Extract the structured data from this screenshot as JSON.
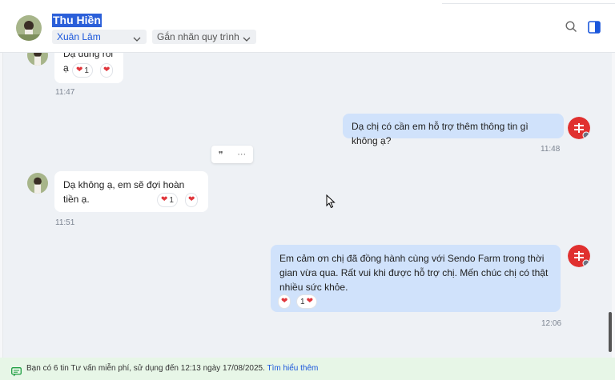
{
  "header": {
    "contact_name": "Thu Hiền",
    "assignee": "Xuân Lâm",
    "label_placeholder": "Gắn nhãn quy trình",
    "icons": [
      "search-icon",
      "sidebar-toggle-icon"
    ]
  },
  "messages": [
    {
      "text": "Dạ đúng rồi ạ",
      "time": "11:47",
      "reaction_count": "1"
    },
    {
      "text": "Dạ chị có cần em hỗ trợ thêm thông tin gì không ạ?",
      "time": "11:48"
    },
    {
      "text": "Dạ không ạ, em sẽ đợi hoàn tiền ạ.",
      "time": "11:51",
      "reaction_count": "1"
    },
    {
      "text": "Em cảm ơn chị đã đồng hành cùng với Sendo Farm trong thời gian vừa qua. Rất vui khi được hỗ trợ chị. Mến chúc chị có thật nhiều sức khỏe.",
      "time": "12:06",
      "reaction_count": "1"
    }
  ],
  "message_actions": {
    "quote": "❞",
    "more": "···"
  },
  "footer": {
    "notice": "Bạn có 6 tin Tư vấn miễn phí, sử dụng đến 12:13 ngày 17/08/2025.",
    "link": "Tìm hiểu thêm"
  },
  "colors": {
    "accent": "#1a56db",
    "outgoing_bubble": "#d0e2fb",
    "chat_bg": "#eef1f5",
    "reaction": "#e0363c",
    "footer_bg": "#e7f6e7",
    "brand": "#e0302f"
  }
}
